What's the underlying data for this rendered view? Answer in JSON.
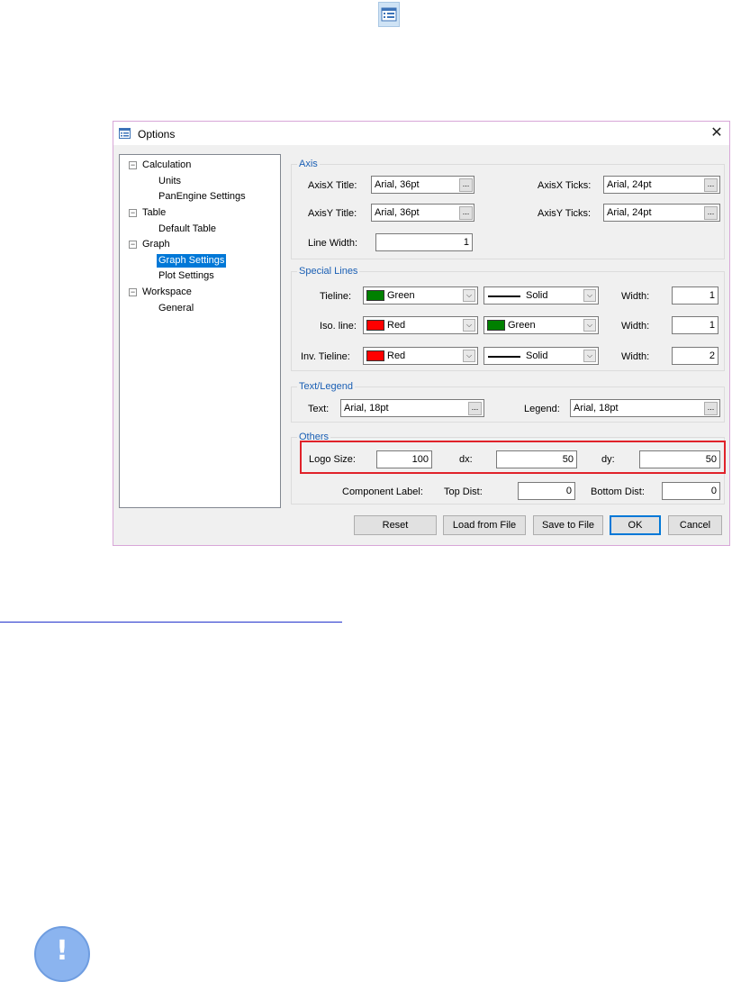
{
  "window": {
    "title": "Options",
    "close_glyph": "✕"
  },
  "icons": {
    "top_icon": "options-list-icon",
    "title_icon": "options-list-icon",
    "notice_icon": "exclamation-icon",
    "notice_glyph": "!"
  },
  "tree": {
    "expander_glyph": "−",
    "items": [
      {
        "label": "Calculation",
        "level": 0
      },
      {
        "label": "Units",
        "level": 1
      },
      {
        "label": "PanEngine Settings",
        "level": 1
      },
      {
        "label": "Table",
        "level": 0
      },
      {
        "label": "Default Table",
        "level": 1
      },
      {
        "label": "Graph",
        "level": 0
      },
      {
        "label": "Graph Settings",
        "level": 1,
        "selected": true
      },
      {
        "label": "Plot Settings",
        "level": 1
      },
      {
        "label": "Workspace",
        "level": 0
      },
      {
        "label": "General",
        "level": 1
      }
    ]
  },
  "axis": {
    "group_title": "Axis",
    "axisx_title_label": "AxisX Title:",
    "axisx_title_value": "Arial, 36pt",
    "axisx_ticks_label": "AxisX Ticks:",
    "axisx_ticks_value": "Arial, 24pt",
    "axisy_title_label": "AxisY Title:",
    "axisy_title_value": "Arial, 36pt",
    "axisy_ticks_label": "AxisY Ticks:",
    "axisy_ticks_value": "Arial, 24pt",
    "line_width_label": "Line Width:",
    "line_width_value": "1",
    "browse_label": "..."
  },
  "special_lines": {
    "group_title": "Special Lines",
    "tieline_label": "Tieline:",
    "tieline_color": "Green",
    "tieline_color_hex": "#008000",
    "tieline_style": "Solid",
    "tieline_width_label": "Width:",
    "tieline_width": "1",
    "iso_label": "Iso. line:",
    "iso_color": "Red",
    "iso_color_hex": "#ff0000",
    "iso_style": "Green",
    "iso_style_hex": "#008000",
    "iso_width_label": "Width:",
    "iso_width": "1",
    "inv_label": "Inv. Tieline:",
    "inv_color": "Red",
    "inv_color_hex": "#ff0000",
    "inv_style": "Solid",
    "inv_width_label": "Width:",
    "inv_width": "2",
    "dropdown_glyph": "⌵"
  },
  "text_legend": {
    "group_title": "Text/Legend",
    "text_label": "Text:",
    "text_value": "Arial, 18pt",
    "legend_label": "Legend:",
    "legend_value": "Arial, 18pt"
  },
  "others": {
    "group_title": "Others",
    "logo_size_label": "Logo Size:",
    "logo_size_value": "100",
    "dx_label": "dx:",
    "dx_value": "50",
    "dy_label": "dy:",
    "dy_value": "50",
    "component_label": "Component Label:",
    "top_dist_label": "Top Dist:",
    "top_dist_value": "0",
    "bottom_dist_label": "Bottom Dist:",
    "bottom_dist_value": "0",
    "highlight_color": "#e0222a"
  },
  "buttons": {
    "reset": "Reset",
    "load": "Load from File",
    "save": "Save to File",
    "ok": "OK",
    "cancel": "Cancel"
  }
}
